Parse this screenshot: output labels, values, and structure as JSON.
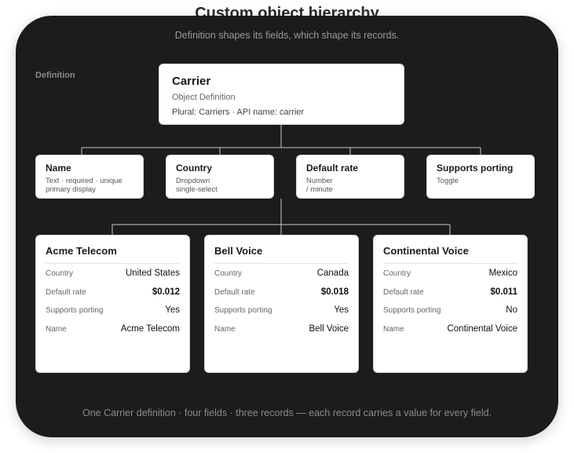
{
  "header": {
    "title": "Custom object hierarchy",
    "subtitle": "Definition shapes its fields, which shape its records."
  },
  "section_label": "Definition",
  "definition": {
    "name": "Carrier",
    "type": "Object Definition",
    "meta": "Plural: Carriers · API name: carrier"
  },
  "fields": [
    {
      "name": "Name",
      "desc": "Text · required · unique\nprimary display"
    },
    {
      "name": "Country",
      "desc": "Dropdown\nsingle-select"
    },
    {
      "name": "Default rate",
      "desc": "Number\n/ minute"
    },
    {
      "name": "Supports porting",
      "desc": "Toggle"
    }
  ],
  "records": [
    {
      "title": "Acme Telecom",
      "rows": [
        {
          "key": "Country",
          "value": "United States"
        },
        {
          "key": "Default rate",
          "value": "$0.012"
        },
        {
          "key": "Supports porting",
          "value": "Yes"
        },
        {
          "key": "Name",
          "value": "Acme Telecom"
        }
      ]
    },
    {
      "title": "Bell Voice",
      "rows": [
        {
          "key": "Country",
          "value": "Canada"
        },
        {
          "key": "Default rate",
          "value": "$0.018"
        },
        {
          "key": "Supports porting",
          "value": "Yes"
        },
        {
          "key": "Name",
          "value": "Bell Voice"
        }
      ]
    },
    {
      "title": "Continental Voice",
      "rows": [
        {
          "key": "Country",
          "value": "Mexico"
        },
        {
          "key": "Default rate",
          "value": "$0.011"
        },
        {
          "key": "Supports porting",
          "value": "No"
        },
        {
          "key": "Name",
          "value": "Continental Voice"
        }
      ]
    }
  ],
  "footer": "One Carrier definition · four fields · three records — each record carries a value for every field.",
  "colors": {
    "frame_bg": "#1c1c1c",
    "card_bg": "#ffffff",
    "connector": "#c8c8c8"
  }
}
